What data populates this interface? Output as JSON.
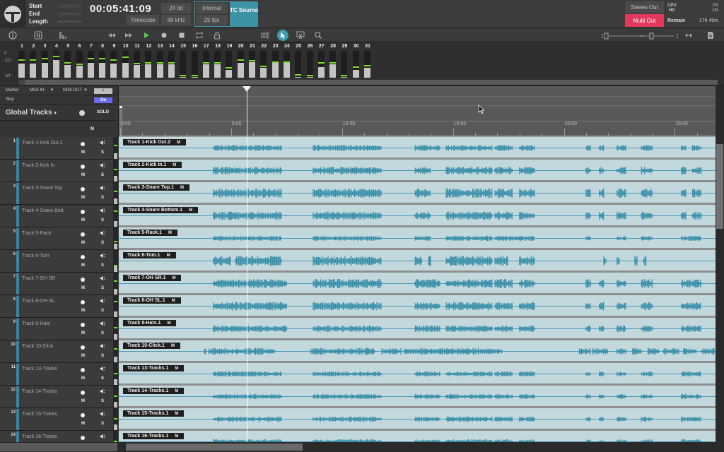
{
  "header": {
    "selection_labels": [
      "Start",
      "End",
      "Length"
    ],
    "selection_values": [
      "--:--:--:--",
      "--:--:--:--",
      "--:--:--:--"
    ],
    "timecode": "00:05:41:09",
    "bit_depth": "24 bit",
    "timecode_mode": "Timecode",
    "sample_rate": "48 kHz",
    "clock": "Internal",
    "frame_rate": "25 fps",
    "tc_source_label": "TC Source",
    "stereo_out": "Stereo Out",
    "multi_out": "Multi Out",
    "cpu_label": "CPU",
    "hd_label": "HD",
    "cpu_value": "2%",
    "hd_value": "1%",
    "remain_label": "Remain",
    "remain_value": "17h 45m",
    "accent_color": "#3d93a6",
    "multi_out_color": "#e0395b"
  },
  "toolbar": {
    "left": [
      {
        "name": "info-icon",
        "glyph": "ⓘ"
      },
      {
        "name": "mixer-icon",
        "glyph": "⇅"
      },
      {
        "name": "meters-icon",
        "glyph": "▙"
      }
    ],
    "transport": [
      {
        "name": "rewind-icon",
        "glyph": "◀◀"
      },
      {
        "name": "fast-forward-icon",
        "glyph": "▶▶"
      },
      {
        "name": "play-icon",
        "glyph": "▶"
      },
      {
        "name": "record-icon",
        "glyph": "●"
      },
      {
        "name": "stop-icon",
        "glyph": "■"
      },
      {
        "name": "loop-icon",
        "glyph": "⟲"
      },
      {
        "name": "lock-icon",
        "glyph": "🔒"
      }
    ],
    "tools": [
      {
        "name": "marker-tool-icon",
        "glyph": "▣"
      },
      {
        "name": "pointer-tool-icon",
        "glyph": "➤",
        "active": true
      },
      {
        "name": "split-tool-icon",
        "glyph": "✂"
      },
      {
        "name": "zoom-tool-icon",
        "glyph": "⚲"
      }
    ],
    "right": [
      {
        "name": "vertical-zoom-slider-icon"
      },
      {
        "name": "horizontal-zoom-slider-icon"
      },
      {
        "name": "fit-width-icon",
        "glyph": "⇔"
      },
      {
        "name": "notes-icon",
        "glyph": "▤"
      }
    ]
  },
  "meter_bridge": {
    "scale": [
      "0 -",
      "-12 -",
      "-Inf -"
    ],
    "channels": [
      {
        "num": "1",
        "level": 0.52,
        "peak": 0.62
      },
      {
        "num": "2",
        "level": 0.52,
        "peak": 0.64
      },
      {
        "num": "3",
        "level": 0.54,
        "peak": 0.69
      },
      {
        "num": "4",
        "level": 0.66,
        "peak": 0.77
      },
      {
        "num": "5",
        "level": 0.48,
        "peak": 0.53
      },
      {
        "num": "6",
        "level": 0.45,
        "peak": 0.48
      },
      {
        "num": "7",
        "level": 0.54,
        "peak": 0.69
      },
      {
        "num": "8",
        "level": 0.54,
        "peak": 0.69
      },
      {
        "num": "9",
        "level": 0.52,
        "peak": 0.62
      },
      {
        "num": "10",
        "level": 0.54,
        "peak": 0.74
      },
      {
        "num": "11",
        "level": 0.48,
        "peak": 0.5
      },
      {
        "num": "12",
        "level": 0.5,
        "peak": 0.53
      },
      {
        "num": "13",
        "level": 0.5,
        "peak": 0.53
      },
      {
        "num": "14",
        "level": 0.5,
        "peak": 0.53
      },
      {
        "num": "15",
        "level": 0.02,
        "peak": 0.05
      },
      {
        "num": "16",
        "level": 0.02,
        "peak": 0.05
      },
      {
        "num": "17",
        "level": 0.5,
        "peak": 0.53
      },
      {
        "num": "18",
        "level": 0.5,
        "peak": 0.53
      },
      {
        "num": "19",
        "level": 0.3,
        "peak": 0.34
      },
      {
        "num": "20",
        "level": 0.54,
        "peak": 0.64
      },
      {
        "num": "21",
        "level": 0.58,
        "peak": 0.6
      },
      {
        "num": "22",
        "level": 0.38,
        "peak": 0.4
      },
      {
        "num": "23",
        "level": 0.54,
        "peak": 0.56
      },
      {
        "num": "24",
        "level": 0.54,
        "peak": 0.56
      },
      {
        "num": "25",
        "level": 0.02,
        "peak": 0.08
      },
      {
        "num": "26",
        "level": 0.02,
        "peak": 0.05
      },
      {
        "num": "27",
        "level": 0.4,
        "peak": 0.53
      },
      {
        "num": "28",
        "level": 0.5,
        "peak": 0.53
      },
      {
        "num": "29",
        "level": 0.02,
        "peak": 0.05
      },
      {
        "num": "30",
        "level": 0.28,
        "peak": 0.36
      },
      {
        "num": "31",
        "level": 0.36,
        "peak": 0.42
      }
    ]
  },
  "left_panel": {
    "marker_label": "Marker",
    "midi_in_label": "MIDI IN",
    "midi_out_label": "MIDI OUT",
    "add_label": "+",
    "skip_label": "Skip",
    "skip_state": "On",
    "global_tracks_label": "Global Tracks",
    "solo_label": "SOLO",
    "mute_label": "M"
  },
  "ruler": {
    "labels": [
      "0:00",
      "5:00",
      "10:00",
      "15:00",
      "20:00",
      "25:00"
    ],
    "minutes_visible": 26.9,
    "playhead_minutes": 5.69
  },
  "tracks": [
    {
      "num": "1",
      "name": "Track 1-Kick Out.1",
      "clip": "Track 1-Kick Out.2",
      "meter": 0.28,
      "peak": 0.62,
      "amp": 0.35,
      "segments": [
        [
          4.2,
          7.3
        ],
        [
          8.7,
          11.8
        ],
        [
          13.3,
          14.4
        ],
        [
          14.7,
          16.8
        ],
        [
          16.9,
          17.7
        ],
        [
          18.0,
          18.7
        ],
        [
          21.0,
          21.2
        ],
        [
          21.6,
          21.8
        ],
        [
          22.4,
          22.8
        ],
        [
          23.5,
          24.0
        ],
        [
          25.3,
          25.5
        ],
        [
          25.8,
          26.2
        ]
      ]
    },
    {
      "num": "2",
      "name": "Track 2-Kick In",
      "clip": "Track 2-Kick In.1",
      "meter": 0.28,
      "peak": 0.58,
      "amp": 0.45,
      "segments": [
        [
          4.2,
          7.3
        ],
        [
          8.7,
          11.8
        ],
        [
          13.3,
          14.0
        ],
        [
          14.7,
          16.8
        ],
        [
          16.9,
          17.7
        ],
        [
          18.0,
          18.7
        ],
        [
          21.0,
          21.2
        ],
        [
          21.6,
          21.8
        ],
        [
          22.4,
          22.8
        ],
        [
          23.5,
          24.0
        ],
        [
          25.3,
          25.5
        ],
        [
          25.8,
          26.2
        ]
      ]
    },
    {
      "num": "3",
      "name": "Track 3-Snare Top",
      "clip": "Track 3-Snare Top.1",
      "meter": 0.28,
      "peak": 0.6,
      "amp": 0.55,
      "segments": [
        [
          4.2,
          7.3
        ],
        [
          8.7,
          11.8
        ],
        [
          13.3,
          14.0
        ],
        [
          14.7,
          16.8
        ],
        [
          16.9,
          17.7
        ],
        [
          18.0,
          18.7
        ],
        [
          21.0,
          21.2
        ],
        [
          21.6,
          21.8
        ],
        [
          22.4,
          22.8
        ],
        [
          23.5,
          24.0
        ],
        [
          25.3,
          25.5
        ],
        [
          25.8,
          26.2
        ]
      ]
    },
    {
      "num": "4",
      "name": "Track 4-Snare Bott",
      "clip": "Track 4-Snare Bottom.1",
      "meter": 0.28,
      "peak": 0.72,
      "amp": 0.5,
      "segments": [
        [
          4.2,
          7.3
        ],
        [
          8.7,
          11.8
        ],
        [
          13.3,
          14.0
        ],
        [
          14.7,
          16.8
        ],
        [
          16.9,
          17.7
        ],
        [
          18.0,
          18.7
        ],
        [
          21.0,
          21.2
        ],
        [
          21.6,
          21.8
        ],
        [
          22.4,
          22.8
        ],
        [
          23.5,
          24.0
        ],
        [
          25.3,
          25.5
        ],
        [
          25.8,
          26.2
        ]
      ]
    },
    {
      "num": "5",
      "name": "Track 5-Rack",
      "clip": "Track 5-Rack.1",
      "meter": 0.28,
      "peak": 0.38,
      "amp": 0.3,
      "segments": [
        [
          4.2,
          7.3
        ],
        [
          8.7,
          11.8
        ],
        [
          13.3,
          14.0
        ],
        [
          14.7,
          16.8
        ],
        [
          16.9,
          18.7
        ],
        [
          21.0,
          21.2
        ],
        [
          22.4,
          22.8
        ],
        [
          23.5,
          24.0
        ],
        [
          25.3,
          26.2
        ]
      ]
    },
    {
      "num": "6",
      "name": "Track 6-Tom",
      "clip": "Track 6-Tom.1",
      "meter": 0.28,
      "peak": 0.3,
      "amp": 0.6,
      "segments": [
        [
          4.2,
          5.0
        ],
        [
          5.2,
          7.3
        ],
        [
          8.7,
          11.8
        ],
        [
          13.3,
          13.6
        ],
        [
          13.9,
          14.0
        ],
        [
          14.7,
          16.8
        ],
        [
          16.9,
          17.5
        ],
        [
          18.0,
          18.7
        ],
        [
          21.8,
          21.9
        ],
        [
          22.4,
          22.5
        ],
        [
          23.2,
          23.3
        ],
        [
          23.6,
          23.7
        ]
      ]
    },
    {
      "num": "7",
      "name": "Track 7-OH SR",
      "clip": "Track 7-OH SR.1",
      "meter": 0.28,
      "peak": 0.62,
      "amp": 0.55,
      "segments": [
        [
          4.2,
          7.5
        ],
        [
          8.7,
          11.8
        ],
        [
          13.3,
          14.4
        ],
        [
          14.7,
          16.8
        ],
        [
          16.9,
          17.7
        ],
        [
          18.0,
          18.7
        ],
        [
          21.0,
          21.2
        ],
        [
          21.6,
          21.8
        ],
        [
          22.4,
          22.8
        ],
        [
          23.5,
          24.0
        ],
        [
          25.3,
          26.2
        ]
      ]
    },
    {
      "num": "8",
      "name": "Track 8-OH SL",
      "clip": "Track 8-OH SL.1",
      "meter": 0.28,
      "peak": 0.72,
      "amp": 0.5,
      "segments": [
        [
          4.2,
          7.5
        ],
        [
          8.7,
          11.8
        ],
        [
          13.3,
          14.4
        ],
        [
          14.7,
          16.8
        ],
        [
          16.9,
          17.7
        ],
        [
          18.0,
          18.7
        ],
        [
          21.0,
          21.2
        ],
        [
          21.6,
          21.8
        ],
        [
          22.4,
          22.8
        ],
        [
          23.5,
          24.0
        ],
        [
          25.3,
          26.2
        ]
      ]
    },
    {
      "num": "9",
      "name": "Track 9-Hats",
      "clip": "Track 9-Hats.1",
      "meter": 0.28,
      "peak": 0.55,
      "amp": 0.4,
      "segments": [
        [
          4.2,
          7.5
        ],
        [
          8.7,
          11.8
        ],
        [
          13.3,
          14.4
        ],
        [
          14.7,
          16.8
        ],
        [
          16.9,
          17.7
        ],
        [
          18.0,
          18.7
        ],
        [
          21.0,
          21.2
        ],
        [
          21.6,
          21.8
        ],
        [
          22.4,
          22.8
        ],
        [
          23.5,
          24.0
        ],
        [
          25.3,
          26.2
        ]
      ]
    },
    {
      "num": "10",
      "name": "Track 10-Click",
      "clip": "Track 10-Click.1",
      "meter": 0.28,
      "peak": 0.62,
      "amp": 0.4,
      "segments": [
        [
          3.8,
          3.85
        ],
        [
          4.0,
          7.0
        ],
        [
          8.6,
          11.5
        ],
        [
          11.8,
          12.7
        ],
        [
          12.8,
          17.2
        ],
        [
          20.7,
          21.2
        ],
        [
          21.3,
          22.0
        ],
        [
          22.4,
          22.8
        ],
        [
          23.1,
          23.5
        ],
        [
          23.8,
          24.3
        ],
        [
          24.5,
          25.2
        ],
        [
          25.4,
          26.0
        ],
        [
          26.2,
          26.8
        ]
      ]
    },
    {
      "num": "11",
      "name": "Track 13-Tracks",
      "clip": "Track 13-Tracks.1",
      "meter": 0.28,
      "peak": 0.52,
      "amp": 0.3,
      "segments": [
        [
          4.2,
          7.3
        ],
        [
          8.7,
          11.8
        ],
        [
          13.3,
          14.4
        ],
        [
          14.7,
          16.8
        ],
        [
          16.9,
          17.7
        ],
        [
          18.0,
          18.7
        ],
        [
          21.0,
          21.2
        ],
        [
          21.6,
          21.8
        ],
        [
          22.4,
          22.8
        ],
        [
          23.5,
          24.0
        ],
        [
          25.3,
          26.2
        ]
      ]
    },
    {
      "num": "12",
      "name": "Track 14-Tracks",
      "clip": "Track 14-Tracks.1",
      "meter": 0.28,
      "peak": 0.52,
      "amp": 0.3,
      "segments": [
        [
          4.2,
          7.3
        ],
        [
          8.7,
          11.8
        ],
        [
          13.3,
          14.4
        ],
        [
          14.7,
          16.8
        ],
        [
          16.9,
          17.7
        ],
        [
          18.0,
          18.7
        ],
        [
          21.0,
          21.2
        ],
        [
          21.6,
          21.8
        ],
        [
          22.4,
          22.8
        ],
        [
          23.5,
          24.0
        ],
        [
          25.3,
          26.2
        ]
      ]
    },
    {
      "num": "13",
      "name": "Track 15-Tracks",
      "clip": "Track 15-Tracks.1",
      "meter": 0.28,
      "peak": 0.52,
      "amp": 0.3,
      "segments": [
        [
          4.2,
          7.3
        ],
        [
          8.7,
          11.8
        ],
        [
          13.3,
          14.4
        ],
        [
          14.7,
          16.8
        ],
        [
          16.9,
          17.7
        ],
        [
          18.0,
          18.7
        ],
        [
          21.0,
          21.2
        ],
        [
          21.6,
          21.8
        ],
        [
          22.4,
          22.8
        ],
        [
          23.5,
          24.0
        ],
        [
          25.3,
          26.2
        ]
      ]
    },
    {
      "num": "14",
      "name": "Track 16-Tracks",
      "clip": "Track 16-Tracks.1",
      "meter": 0.28,
      "peak": 0.52,
      "amp": 0.3,
      "segments": [
        [
          4.2,
          7.3
        ],
        [
          8.7,
          11.8
        ],
        [
          13.3,
          14.4
        ],
        [
          14.7,
          16.8
        ],
        [
          16.9,
          17.7
        ],
        [
          18.0,
          18.7
        ],
        [
          21.0,
          21.2
        ],
        [
          21.6,
          21.8
        ],
        [
          22.4,
          22.8
        ],
        [
          23.5,
          24.0
        ],
        [
          25.3,
          26.2
        ]
      ]
    }
  ]
}
